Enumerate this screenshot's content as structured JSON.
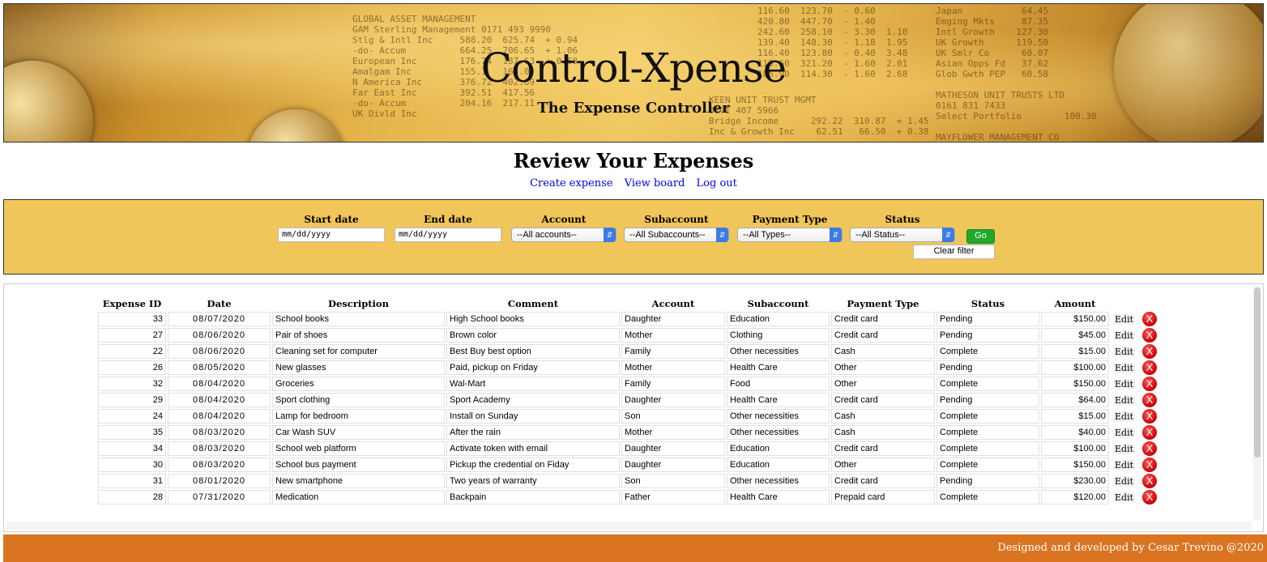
{
  "banner": {
    "title": "Control-Xpense",
    "subtitle": "The Expense Controller"
  },
  "page": {
    "title": "Review Your Expenses"
  },
  "nav": {
    "create": "Create expense",
    "view_board": "View board",
    "logout": "Log out"
  },
  "filters": {
    "start_date_label": "Start date",
    "start_date_placeholder": "mm/dd/yyyy",
    "end_date_label": "End date",
    "end_date_placeholder": "mm/dd/yyyy",
    "account_label": "Account",
    "account_value": "--All accounts--",
    "subaccount_label": "Subaccount",
    "subaccount_value": "--All Subaccounts--",
    "payment_label": "Payment Type",
    "payment_value": "--All Types--",
    "status_label": "Status",
    "status_value": "--All Status--",
    "go_label": "Go",
    "clear_label": "Clear filter"
  },
  "table": {
    "headers": [
      "Expense ID",
      "Date",
      "Description",
      "Comment",
      "Account",
      "Subaccount",
      "Payment Type",
      "Status",
      "Amount"
    ],
    "edit_label": "Edit",
    "delete_label": "X",
    "rows": [
      {
        "id": "33",
        "date": "08/07/2020",
        "description": "School books",
        "comment": "High School books",
        "account": "Daughter",
        "subaccount": "Education",
        "payment": "Credit card",
        "status": "Pending",
        "amount": "$150.00"
      },
      {
        "id": "27",
        "date": "08/06/2020",
        "description": "Pair of shoes",
        "comment": "Brown color",
        "account": "Mother",
        "subaccount": "Clothing",
        "payment": "Credit card",
        "status": "Pending",
        "amount": "$45.00"
      },
      {
        "id": "22",
        "date": "08/06/2020",
        "description": "Cleaning set for computer",
        "comment": "Best Buy best option",
        "account": "Family",
        "subaccount": "Other necessities",
        "payment": "Cash",
        "status": "Complete",
        "amount": "$15.00"
      },
      {
        "id": "26",
        "date": "08/05/2020",
        "description": "New glasses",
        "comment": "Paid, pickup on Friday",
        "account": "Mother",
        "subaccount": "Health Care",
        "payment": "Other",
        "status": "Pending",
        "amount": "$100.00"
      },
      {
        "id": "32",
        "date": "08/04/2020",
        "description": "Groceries",
        "comment": "Wal-Mart",
        "account": "Family",
        "subaccount": "Food",
        "payment": "Other",
        "status": "Complete",
        "amount": "$150.00"
      },
      {
        "id": "29",
        "date": "08/04/2020",
        "description": "Sport clothing",
        "comment": "Sport Academy",
        "account": "Daughter",
        "subaccount": "Health Care",
        "payment": "Credit card",
        "status": "Pending",
        "amount": "$64.00"
      },
      {
        "id": "24",
        "date": "08/04/2020",
        "description": "Lamp for bedroom",
        "comment": "Install on Sunday",
        "account": "Son",
        "subaccount": "Other necessities",
        "payment": "Cash",
        "status": "Complete",
        "amount": "$15.00"
      },
      {
        "id": "35",
        "date": "08/03/2020",
        "description": "Car Wash SUV",
        "comment": "After the rain",
        "account": "Mother",
        "subaccount": "Other necessities",
        "payment": "Cash",
        "status": "Complete",
        "amount": "$40.00"
      },
      {
        "id": "34",
        "date": "08/03/2020",
        "description": "School web platform",
        "comment": "Activate token with email",
        "account": "Daughter",
        "subaccount": "Education",
        "payment": "Credit card",
        "status": "Complete",
        "amount": "$100.00"
      },
      {
        "id": "30",
        "date": "08/03/2020",
        "description": "School bus payment",
        "comment": "Pickup the credential on Fiday",
        "account": "Daughter",
        "subaccount": "Education",
        "payment": "Other",
        "status": "Complete",
        "amount": "$150.00"
      },
      {
        "id": "31",
        "date": "08/01/2020",
        "description": "New smartphone",
        "comment": "Two years of warranty",
        "account": "Son",
        "subaccount": "Other necessities",
        "payment": "Credit card",
        "status": "Pending",
        "amount": "$230.00"
      },
      {
        "id": "28",
        "date": "07/31/2020",
        "description": "Medication",
        "comment": "Backpain",
        "account": "Father",
        "subaccount": "Health Care",
        "payment": "Prepaid card",
        "status": "Complete",
        "amount": "$120.00"
      }
    ]
  },
  "footer": {
    "text": "Designed and developed by Cesar Trevino @2020"
  },
  "colors": {
    "filter_bg": "#f0c65a",
    "footer_bg": "#da7421",
    "go_button": "#22a82c",
    "delete_button": "#c80000",
    "link": "#0000ee"
  },
  "icons": {
    "delete": "close-circle-icon",
    "select": "chevron-updown-icon"
  }
}
